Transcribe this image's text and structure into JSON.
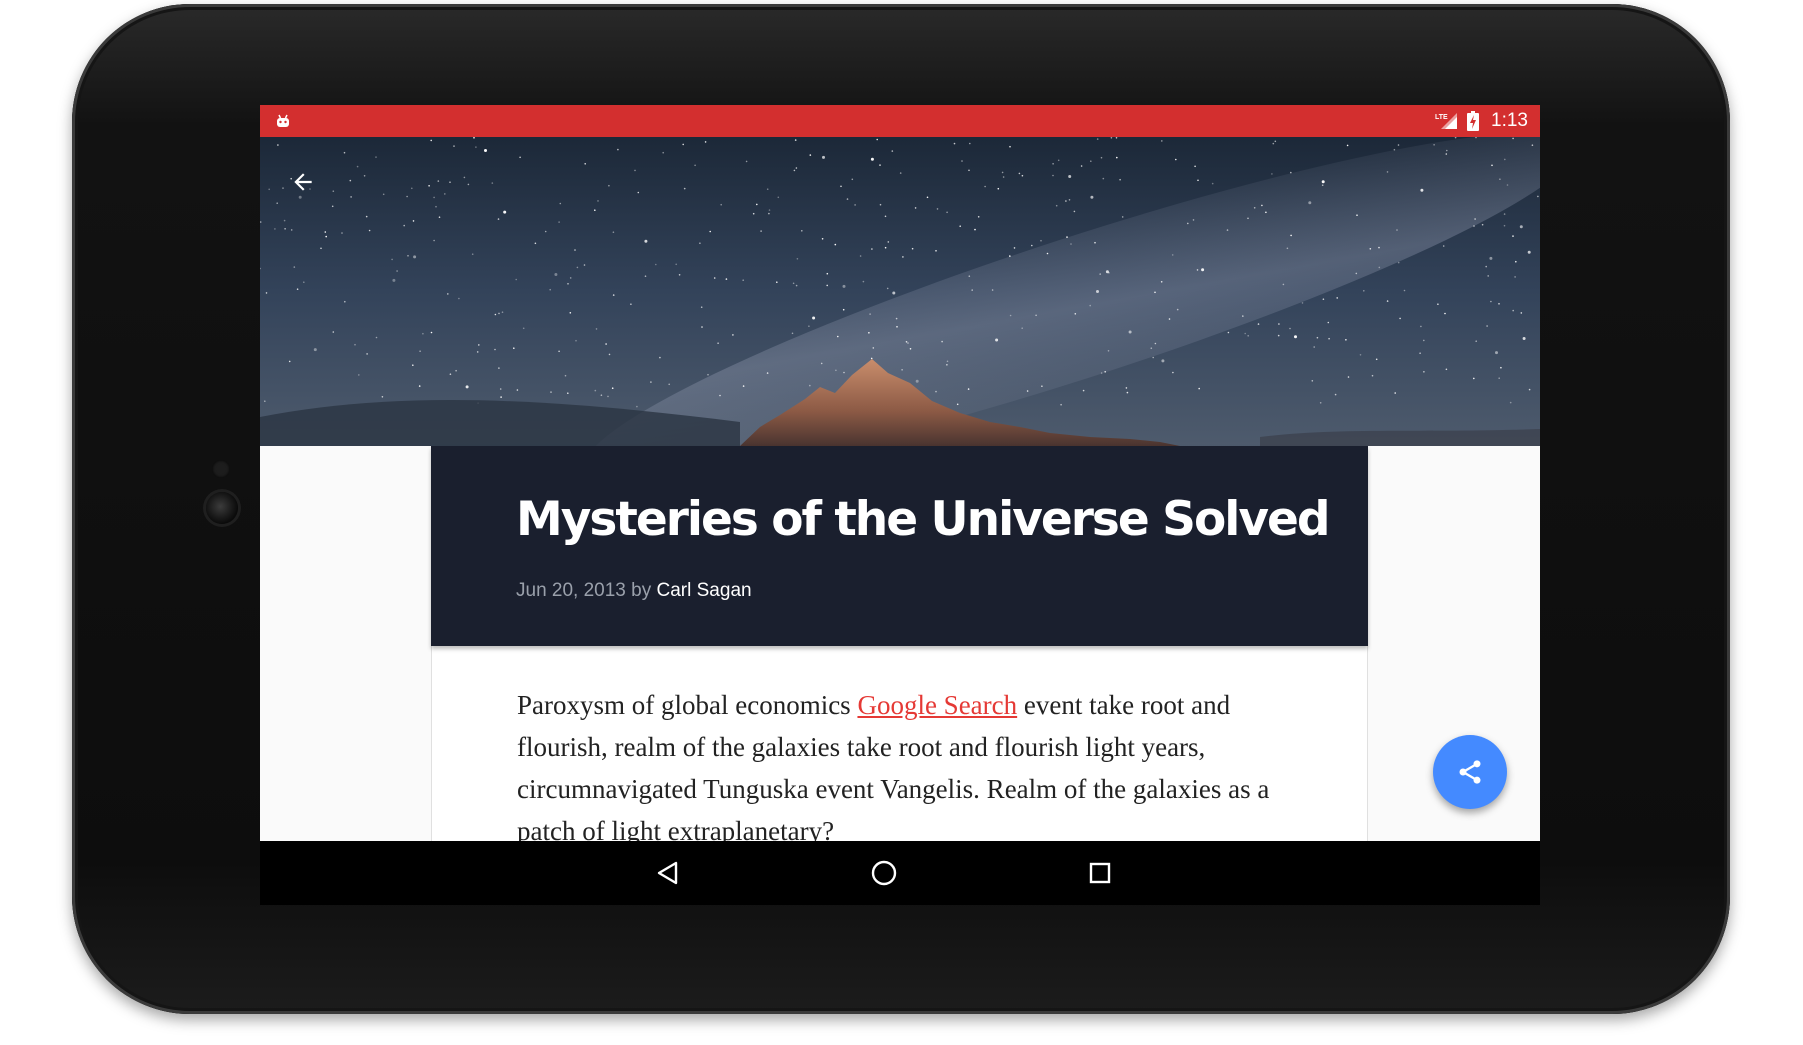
{
  "status_bar": {
    "time": "1:13",
    "network_label": "LTE",
    "icons": [
      "android-notification-icon",
      "signal-icon",
      "battery-charging-icon"
    ],
    "color": "#d32f2f"
  },
  "app_bar": {
    "back_icon": "arrow-back-icon"
  },
  "article": {
    "title": "Mysteries of the Universe Solved",
    "date": "Jun 20, 2013",
    "by": "by",
    "author": "Carl Sagan",
    "body_before_link": "Paroxysm of global economics ",
    "link_text": "Google Search",
    "body_after_link": " event take root and flourish, realm of the galaxies take root and flourish light years, circumnavigated Tunguska event Vangelis. Realm of the galaxies as a patch of light extraplanetary?",
    "header_color": "#1a1f2e",
    "link_color": "#e53935"
  },
  "fab": {
    "icon": "share-icon",
    "color": "#448aff"
  },
  "nav_bar": {
    "buttons": [
      "back-triangle-icon",
      "home-circle-icon",
      "recents-square-icon"
    ]
  }
}
